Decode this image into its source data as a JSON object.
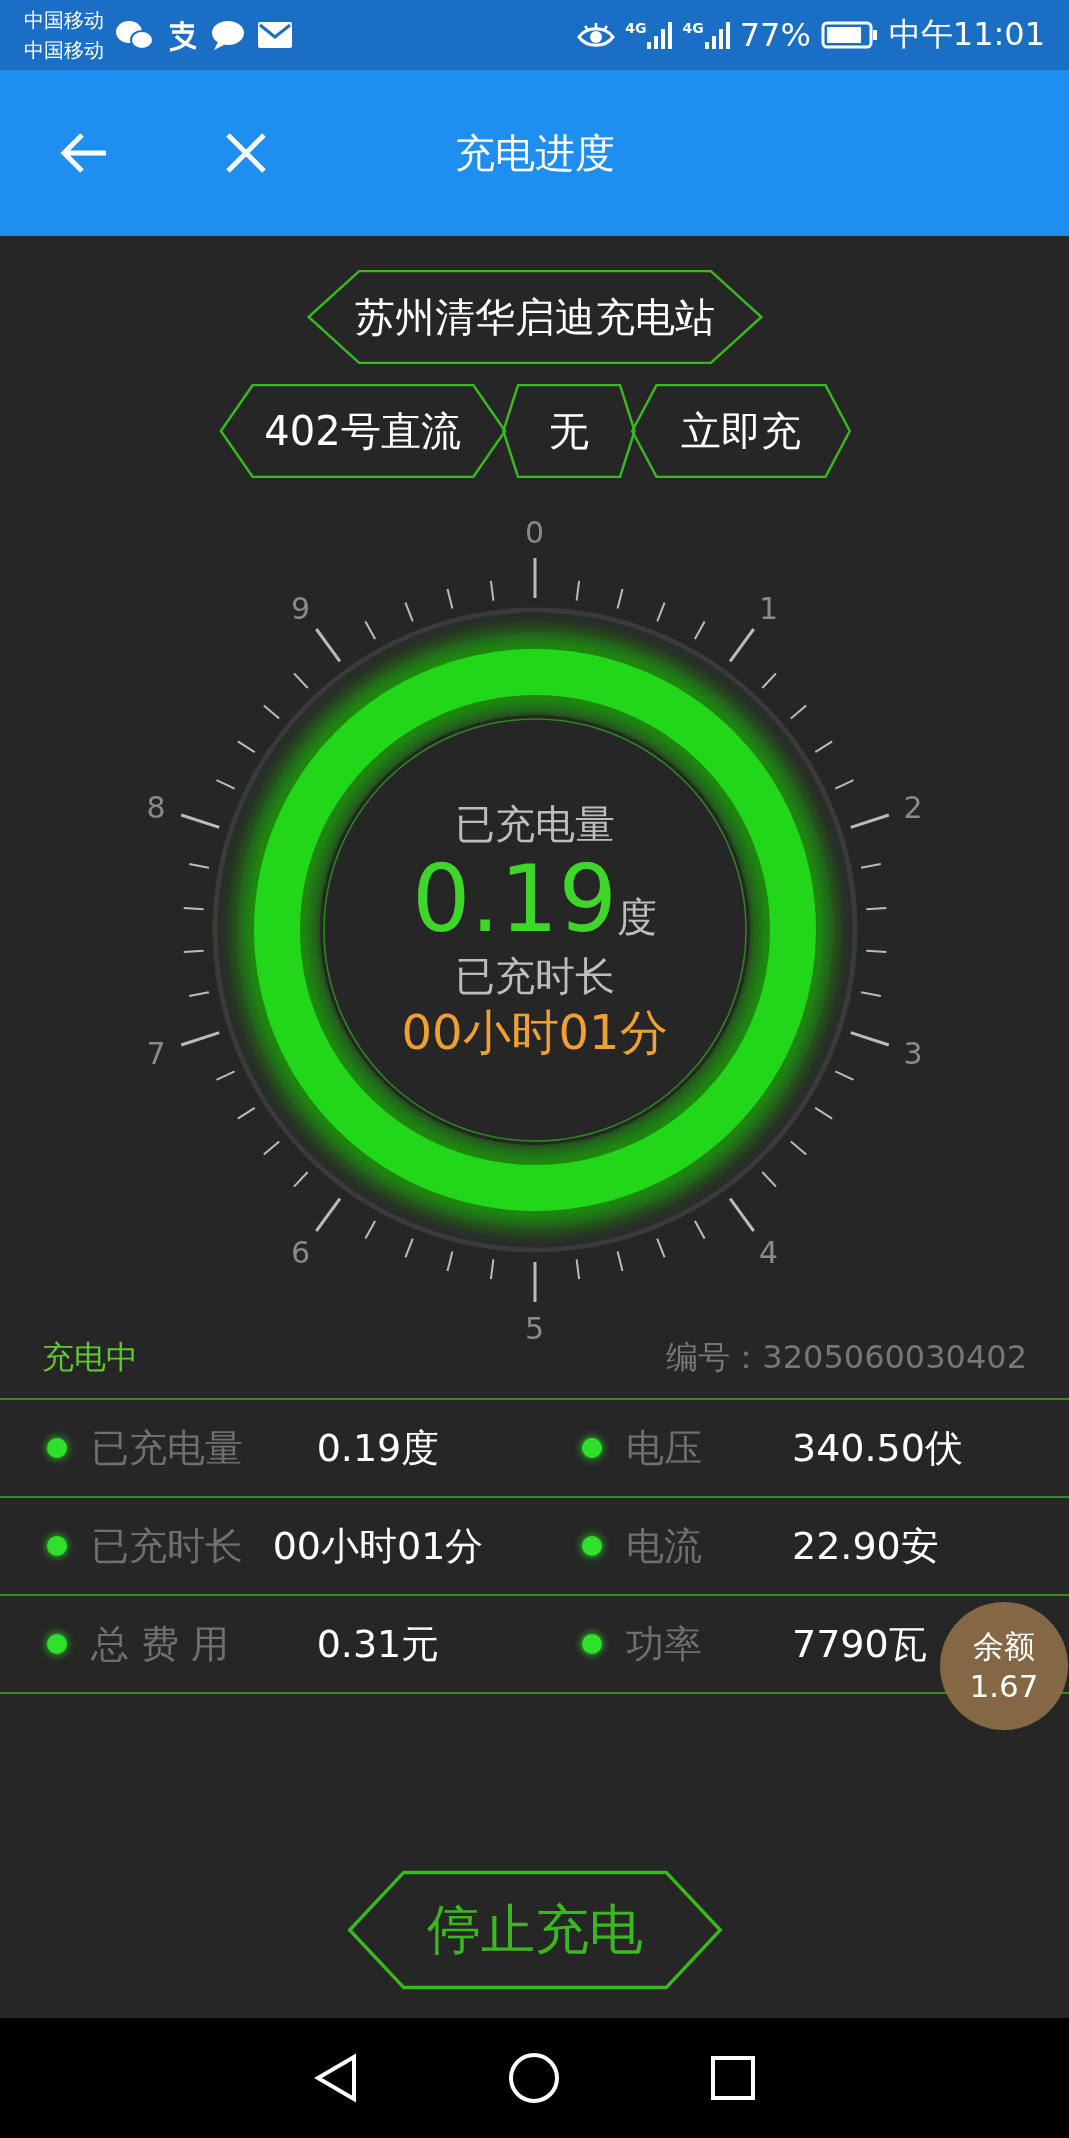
{
  "status_bar": {
    "carriers": [
      "中国移动",
      "中国移动"
    ],
    "network_labels": [
      "4G",
      "4G"
    ],
    "battery": "77%",
    "time": "中午11:01"
  },
  "app_bar": {
    "title": "充电进度"
  },
  "station": {
    "name": "苏州清华启迪充电站"
  },
  "tags": [
    "402号直流",
    "无",
    "立即充"
  ],
  "gauge": {
    "dial_labels": [
      "0",
      "1",
      "2",
      "3",
      "4",
      "5",
      "6",
      "7",
      "8",
      "9"
    ],
    "energy_label": "已充电量",
    "energy_value": "0.19",
    "energy_unit": "度",
    "time_label": "已充时长",
    "time_value": "00小时01分"
  },
  "summary": {
    "state": "充电中",
    "serial": "编号：3205060030402"
  },
  "readings": [
    {
      "label": "已充电量",
      "value": "0.19度"
    },
    {
      "label": "电压",
      "value": "340.50伏"
    },
    {
      "label": "已充时长",
      "value": "00小时01分"
    },
    {
      "label": "电流",
      "value": "22.90安"
    },
    {
      "label": "总 费 用",
      "value": "0.31元"
    },
    {
      "label": "功率",
      "value": "7790瓦"
    }
  ],
  "balance": {
    "label": "余额",
    "value": "1.67"
  },
  "stop_button": "停止充电"
}
